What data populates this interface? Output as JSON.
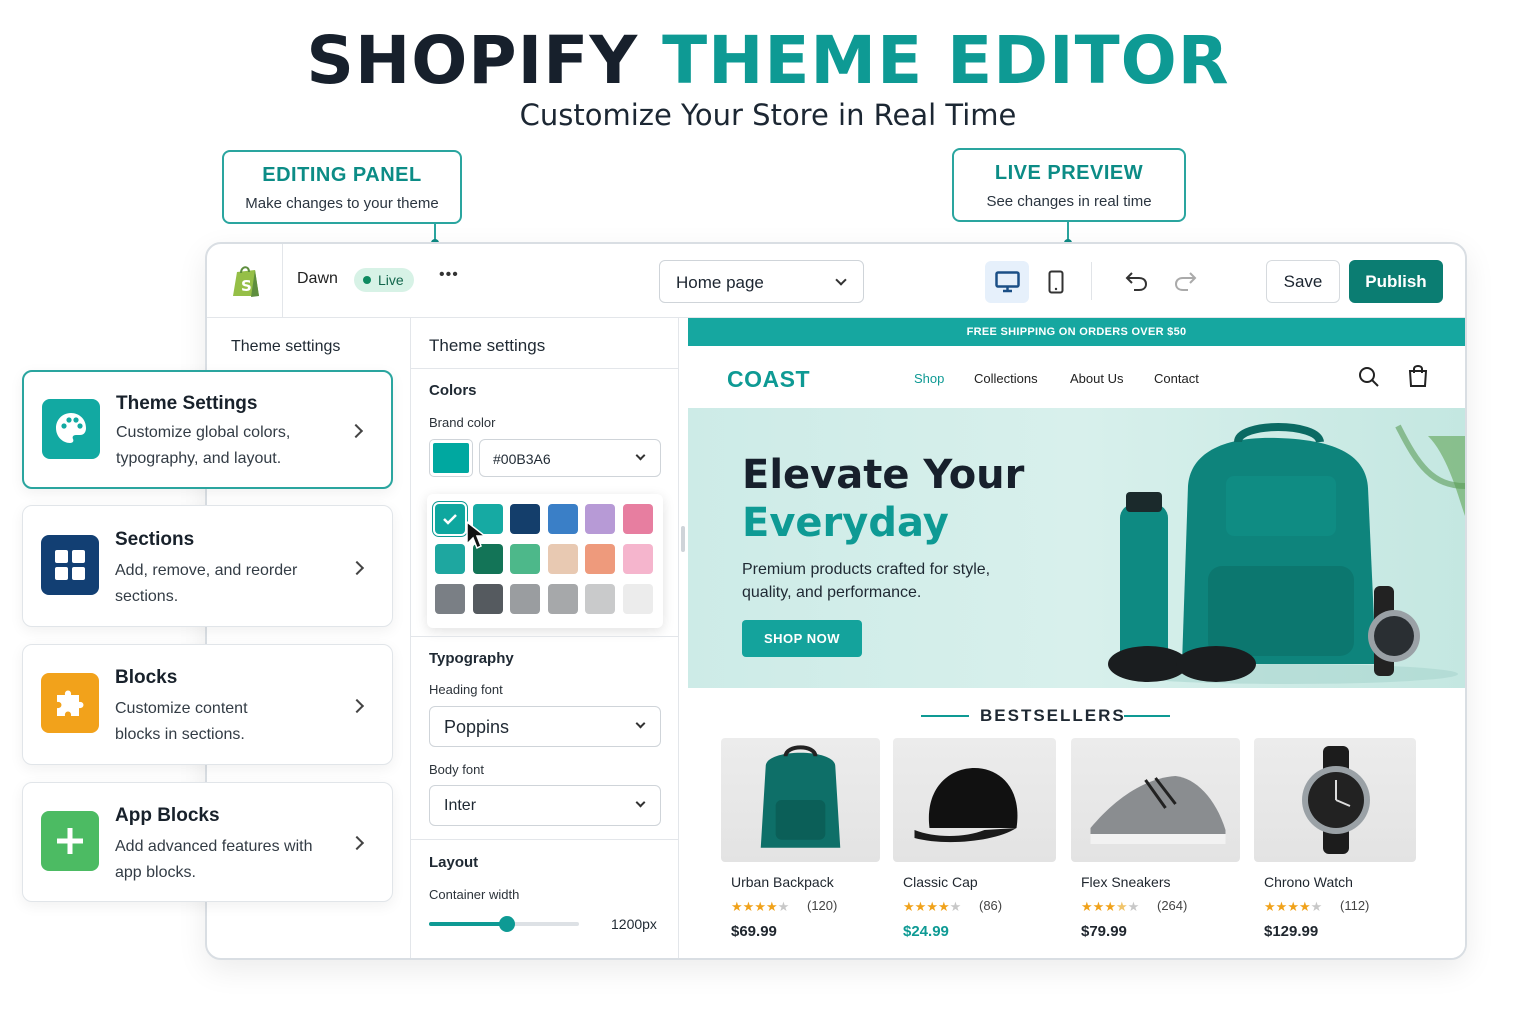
{
  "heading": {
    "title_main": "SHOPIFY",
    "title_accent": "THEME EDITOR",
    "subtitle": "Customize Your Store in Real Time"
  },
  "callouts": {
    "editing": {
      "title": "EDITING PANEL",
      "sub": "Make changes to your theme"
    },
    "preview": {
      "title": "LIVE PREVIEW",
      "sub": "See changes in real time"
    }
  },
  "topbar": {
    "theme_name": "Dawn",
    "status": "Live",
    "more": "•••",
    "page_select": "Home page",
    "save": "Save",
    "publish": "Publish"
  },
  "left_nav": {
    "title": "Theme settings"
  },
  "cards": [
    {
      "title": "Theme Settings",
      "desc": "Customize global colors, typography, and layout.",
      "icon": "palette-icon",
      "color": "#12a9a2"
    },
    {
      "title": "Sections",
      "desc": "Add, remove, and reorder sections.",
      "icon": "grid-icon",
      "color": "#123f73"
    },
    {
      "title": "Blocks",
      "desc": "Customize content blocks in sections.",
      "icon": "puzzle-icon",
      "color": "#f2a21b"
    },
    {
      "title": "App Blocks",
      "desc": "Add advanced features with app blocks.",
      "icon": "plus-icon",
      "color": "#4cbb63"
    }
  ],
  "settings": {
    "title": "Theme settings",
    "colors": {
      "heading": "Colors",
      "brand_label": "Brand color",
      "brand_value": "#00B3A6"
    },
    "palette": [
      "#0fa79f",
      "#16aaa3",
      "#143e6b",
      "#3a7fc7",
      "#b79ad6",
      "#e77ea0",
      "#1ea7a0",
      "#137457",
      "#4db88a",
      "#e8c9b2",
      "#ee9a7c",
      "#f5b5cd",
      "#7a7f85",
      "#555a5f",
      "#9a9da0",
      "#a6a8aa",
      "#c9cacb",
      "#ececec"
    ],
    "typography": {
      "heading": "Typography",
      "heading_font_label": "Heading font",
      "heading_font": "Poppins",
      "body_font_label": "Body font",
      "body_font": "Inter"
    },
    "layout": {
      "heading": "Layout",
      "width_label": "Container width",
      "width_value": "1200px",
      "width_fraction": 0.52
    }
  },
  "store": {
    "banner": "FREE SHIPPING ON ORDERS OVER $50",
    "logo": "COAST",
    "nav": [
      "Shop",
      "Collections",
      "About Us",
      "Contact"
    ],
    "hero": {
      "line1": "Elevate Your",
      "line2": "Everyday",
      "text": "Premium products crafted for style, quality, and performance.",
      "cta": "SHOP NOW"
    },
    "bestsellers": "BESTSELLERS",
    "products": [
      {
        "name": "Urban Backpack",
        "rating": 4,
        "reviews": "(120)",
        "price": "$69.99"
      },
      {
        "name": "Classic Cap",
        "rating": 4,
        "reviews": "(86)",
        "price": "$24.99"
      },
      {
        "name": "Flex Sneakers",
        "rating": 3.5,
        "reviews": "(264)",
        "price": "$79.99"
      },
      {
        "name": "Chrono Watch",
        "rating": 4,
        "reviews": "(112)",
        "price": "$129.99"
      }
    ]
  },
  "colors": {
    "accent": "#0e9a94",
    "publish": "#0b7d72",
    "live_bg": "#d7f2e6"
  }
}
